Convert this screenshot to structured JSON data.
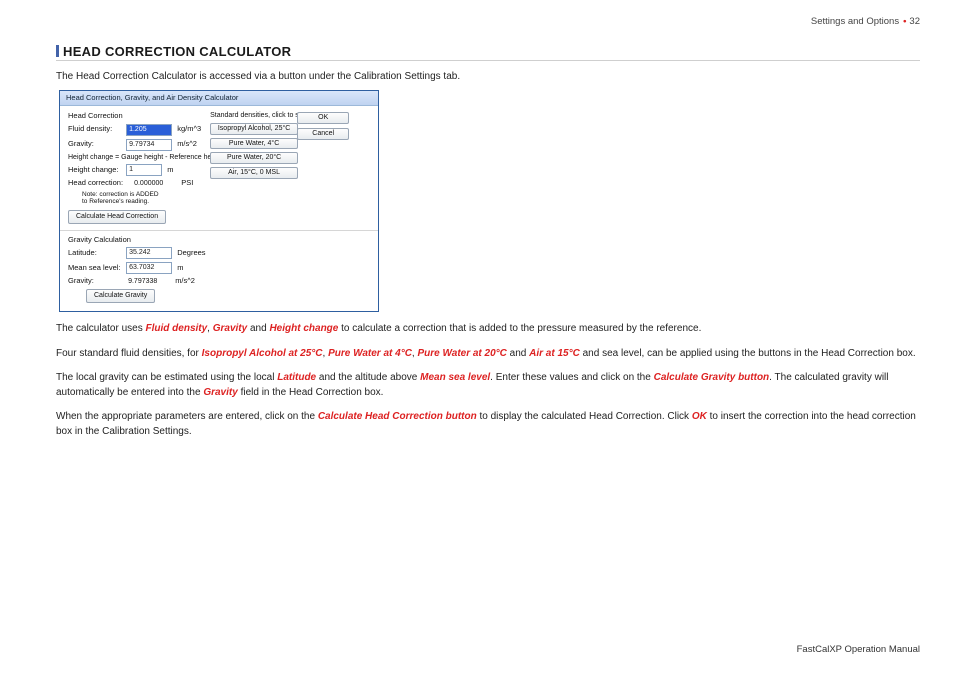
{
  "header": {
    "section": "Settings and Options",
    "page": "32"
  },
  "title": "HEAD CORRECTION CALCULATOR",
  "intro": "The Head Correction Calculator is accessed via a button under the Calibration Settings tab.",
  "dialog": {
    "window_title": "Head Correction, Gravity, and Air Density Calculator",
    "head_section_title": "Head Correction",
    "fluid_density": {
      "label": "Fluid density:",
      "value": "1.205",
      "unit": "kg/m^3"
    },
    "gravity_in": {
      "label": "Gravity:",
      "value": "9.79734",
      "unit": "m/s^2"
    },
    "height_note": "Height change = Gauge height - Reference height",
    "height_change": {
      "label": "Height change:",
      "value": "1",
      "unit": "m"
    },
    "head_corr": {
      "label": "Head correction:",
      "value": "0.000000",
      "unit": "PSI"
    },
    "note_line1": "Note: correction is ADDED",
    "note_line2": "to Reference's reading.",
    "calc_head_btn": "Calculate Head Correction",
    "presets_heading": "Standard densities, click to set",
    "presets": [
      "Isopropyl Alcohol, 25°C",
      "Pure Water, 4°C",
      "Pure Water, 20°C",
      "Air, 15°C, 0 MSL"
    ],
    "ok_label": "OK",
    "cancel_label": "Cancel",
    "grav_section_title": "Gravity Calculation",
    "latitude": {
      "label": "Latitude:",
      "value": "35.242",
      "unit": "Degrees"
    },
    "msl": {
      "label": "Mean sea level:",
      "value": "63.7032",
      "unit": "m"
    },
    "gravity_out": {
      "label": "Gravity:",
      "value": "9.797338",
      "unit": "m/s^2"
    },
    "calc_gravity_btn": "Calculate Gravity"
  },
  "para1": {
    "t1": "The calculator uses ",
    "k1": "Fluid density",
    "t2": ", ",
    "k2": "Gravity",
    "t3": " and ",
    "k3": "Height change",
    "t4": " to calculate a correction that is added to the pressure measured by the reference."
  },
  "para2": {
    "t1": "Four standard fluid densities, for ",
    "k1": "Isopropyl Alcohol at 25°C",
    "t2": ", ",
    "k2": "Pure Water at 4°C",
    "t3": ", ",
    "k3": "Pure Water at 20°C",
    "t4": " and ",
    "k4": "Air at 15°C",
    "t5": " and sea level, can be applied using the buttons in the Head Correction box."
  },
  "para3": {
    "t1": "The local gravity can be estimated using the local ",
    "k1": "Latitude",
    "t2": " and the altitude above ",
    "k2": "Mean sea level",
    "t3": ". Enter these values and click on the ",
    "k3": "Calculate Gravity button",
    "t4": ". The calculated gravity will automatically be entered into the ",
    "k4": "Gravity",
    "t5": " field in the Head Correction box."
  },
  "para4": {
    "t1": "When the appropriate parameters are entered, click on the ",
    "k1": "Calculate Head Correction button",
    "t2": " to display the calculated Head Correction. Click ",
    "k2": "OK",
    "t3": " to insert the correction into the head correction box in the Calibration Settings."
  },
  "footer": "FastCalXP Operation Manual"
}
